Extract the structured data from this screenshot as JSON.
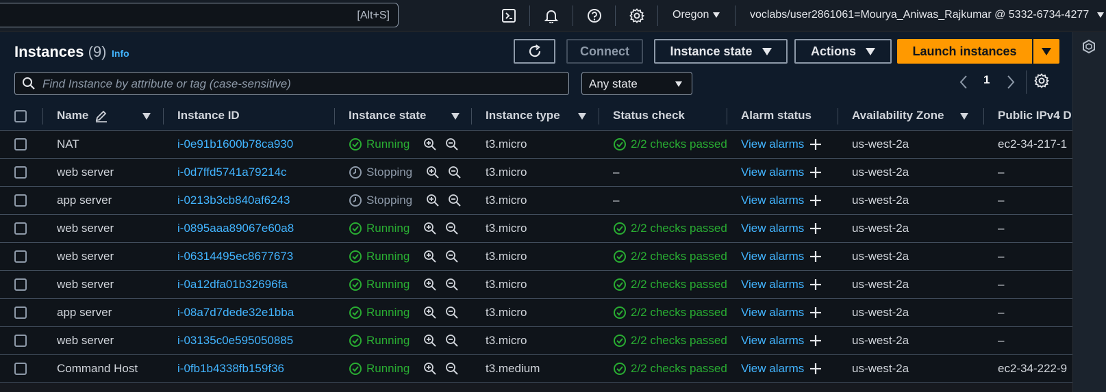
{
  "topbar": {
    "search_shortcut": "[Alt+S]",
    "region": "Oregon",
    "account": "voclabs/user2861061=Mourya_Aniwas_Rajkumar @ 5332-6734-4277"
  },
  "header": {
    "title": "Instances",
    "count": "(9)",
    "info": "Info",
    "connect_label": "Connect",
    "instance_state_label": "Instance state",
    "actions_label": "Actions",
    "launch_label": "Launch instances",
    "filter_placeholder": "Find Instance by attribute or tag (case-sensitive)",
    "state_filter": "Any state",
    "page_number": "1"
  },
  "table": {
    "columns": [
      "Name",
      "Instance ID",
      "Instance state",
      "Instance type",
      "Status check",
      "Alarm status",
      "Availability Zone",
      "Public IPv4 D"
    ],
    "rows": [
      {
        "name": "NAT",
        "id": "i-0e91b1600b78ca930",
        "state": "Running",
        "type": "t3.micro",
        "status": "2/2 checks passed",
        "alarm": "View alarms",
        "az": "us-west-2a",
        "ipv4": "ec2-34-217-1"
      },
      {
        "name": "web server",
        "id": "i-0d7ffd5741a79214c",
        "state": "Stopping",
        "type": "t3.micro",
        "status": "–",
        "alarm": "View alarms",
        "az": "us-west-2a",
        "ipv4": "–"
      },
      {
        "name": "app server",
        "id": "i-0213b3cb840af6243",
        "state": "Stopping",
        "type": "t3.micro",
        "status": "–",
        "alarm": "View alarms",
        "az": "us-west-2a",
        "ipv4": "–"
      },
      {
        "name": "web server",
        "id": "i-0895aaa89067e60a8",
        "state": "Running",
        "type": "t3.micro",
        "status": "2/2 checks passed",
        "alarm": "View alarms",
        "az": "us-west-2a",
        "ipv4": "–"
      },
      {
        "name": "web server",
        "id": "i-06314495ec8677673",
        "state": "Running",
        "type": "t3.micro",
        "status": "2/2 checks passed",
        "alarm": "View alarms",
        "az": "us-west-2a",
        "ipv4": "–"
      },
      {
        "name": "web server",
        "id": "i-0a12dfa01b32696fa",
        "state": "Running",
        "type": "t3.micro",
        "status": "2/2 checks passed",
        "alarm": "View alarms",
        "az": "us-west-2a",
        "ipv4": "–"
      },
      {
        "name": "app server",
        "id": "i-08a7d7dede32e1bba",
        "state": "Running",
        "type": "t3.micro",
        "status": "2/2 checks passed",
        "alarm": "View alarms",
        "az": "us-west-2a",
        "ipv4": "–"
      },
      {
        "name": "web server",
        "id": "i-03135c0e595050885",
        "state": "Running",
        "type": "t3.micro",
        "status": "2/2 checks passed",
        "alarm": "View alarms",
        "az": "us-west-2a",
        "ipv4": "–"
      },
      {
        "name": "Command Host",
        "id": "i-0fb1b4338fb159f36",
        "state": "Running",
        "type": "t3.medium",
        "status": "2/2 checks passed",
        "alarm": "View alarms",
        "az": "us-west-2a",
        "ipv4": "ec2-34-222-9"
      }
    ]
  },
  "colors": {
    "accent": "#ff9900",
    "link": "#42b4ff",
    "success": "#29ad32",
    "muted": "#8d99a8"
  }
}
